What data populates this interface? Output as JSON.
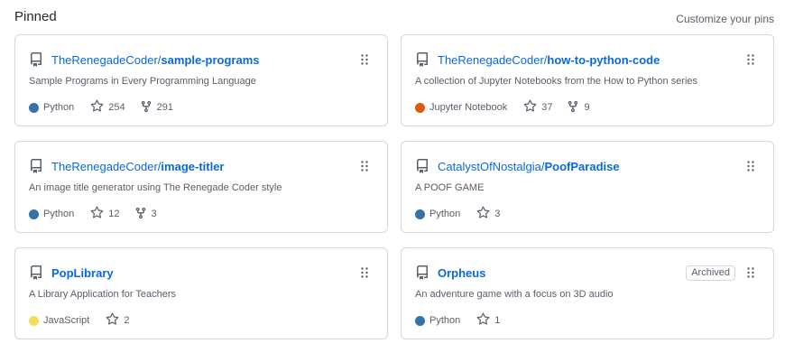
{
  "header": {
    "title": "Pinned",
    "customize": "Customize your pins"
  },
  "colors": {
    "Python": "#3572A5",
    "Jupyter Notebook": "#DA5B0B",
    "JavaScript": "#f1e05a",
    "link": "#0969da",
    "muted": "#57606a"
  },
  "cards": [
    {
      "owner": "TheRenegadeCoder/",
      "name": "sample-programs",
      "description": "Sample Programs in Every Programming Language",
      "language": "Python",
      "lang_color": "#3572A5",
      "stars": "254",
      "forks": "291"
    },
    {
      "owner": "TheRenegadeCoder/",
      "name": "how-to-python-code",
      "description": "A collection of Jupyter Notebooks from the How to Python series",
      "language": "Jupyter Notebook",
      "lang_color": "#DA5B0B",
      "stars": "37",
      "forks": "9"
    },
    {
      "owner": "TheRenegadeCoder/",
      "name": "image-titler",
      "description": "An image title generator using The Renegade Coder style",
      "language": "Python",
      "lang_color": "#3572A5",
      "stars": "12",
      "forks": "3"
    },
    {
      "owner": "CatalystOfNostalgia/",
      "name": "PoofParadise",
      "description": "A POOF GAME",
      "language": "Python",
      "lang_color": "#3572A5",
      "stars": "3"
    },
    {
      "owner": "",
      "name": "PopLibrary",
      "description": "A Library Application for Teachers",
      "language": "JavaScript",
      "lang_color": "#f1e05a",
      "stars": "2"
    },
    {
      "owner": "",
      "name": "Orpheus",
      "description": "An adventure game with a focus on 3D audio",
      "language": "Python",
      "lang_color": "#3572A5",
      "stars": "1",
      "badge": "Archived"
    }
  ],
  "icons": {
    "repo": "repo-icon",
    "drag": "grip-vertical-icon",
    "star": "star-icon",
    "fork": "fork-icon"
  }
}
